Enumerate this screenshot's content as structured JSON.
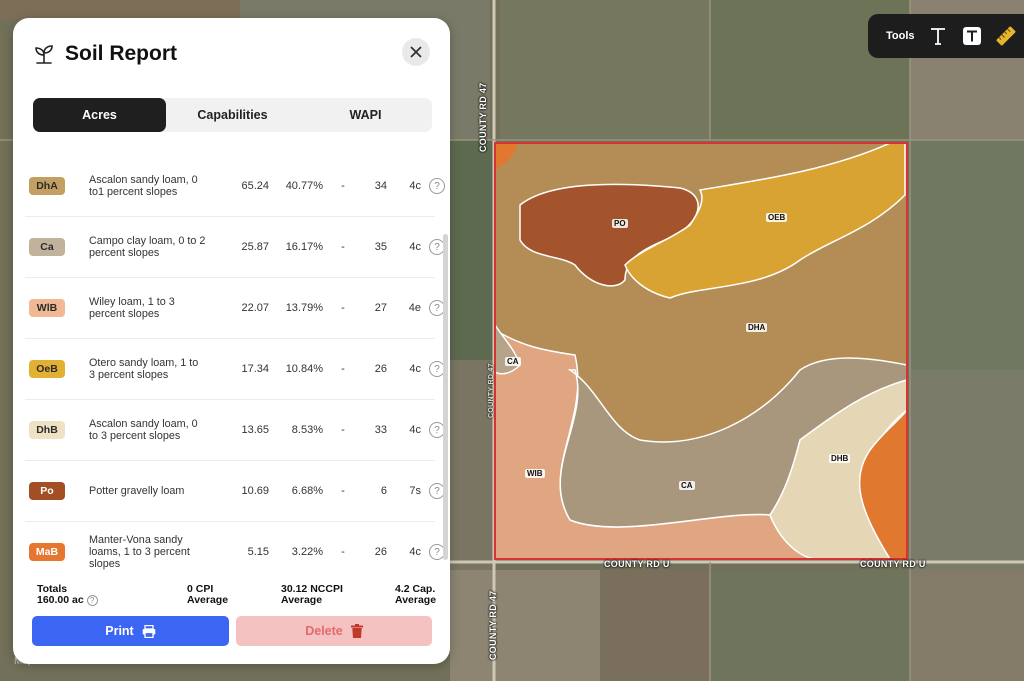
{
  "panel": {
    "title": "Soil Report",
    "tabs": [
      {
        "label": "Acres",
        "active": true
      },
      {
        "label": "Capabilities",
        "active": false
      },
      {
        "label": "WAPI",
        "active": false
      }
    ],
    "rows": [
      {
        "code": "DhA",
        "color": "#c3a061",
        "text_color": "#2b2b2b",
        "name": "Ascalon sandy loam, 0 to1 percent slopes",
        "acres": "65.24",
        "percent": "40.77%",
        "cpi": "-",
        "nccpi": "34",
        "cap": "4c"
      },
      {
        "code": "Ca",
        "color": "#c2b29b",
        "text_color": "#2b2b2b",
        "name": "Campo clay loam, 0 to 2 percent slopes",
        "acres": "25.87",
        "percent": "16.17%",
        "cpi": "-",
        "nccpi": "35",
        "cap": "4c"
      },
      {
        "code": "WlB",
        "color": "#f0b893",
        "text_color": "#2b2b2b",
        "name": "Wiley loam, 1 to 3 percent slopes",
        "acres": "22.07",
        "percent": "13.79%",
        "cpi": "-",
        "nccpi": "27",
        "cap": "4e"
      },
      {
        "code": "OeB",
        "color": "#e2b134",
        "text_color": "#2b2b2b",
        "name": "Otero sandy loam, 1 to 3 percent slopes",
        "acres": "17.34",
        "percent": "10.84%",
        "cpi": "-",
        "nccpi": "26",
        "cap": "4c"
      },
      {
        "code": "DhB",
        "color": "#efe1c3",
        "text_color": "#2b2b2b",
        "name": "Ascalon sandy loam, 0 to 3 percent slopes",
        "acres": "13.65",
        "percent": "8.53%",
        "cpi": "-",
        "nccpi": "33",
        "cap": "4c"
      },
      {
        "code": "Po",
        "color": "#a24f25",
        "text_color": "#ffffff",
        "name": "Potter gravelly loam",
        "acres": "10.69",
        "percent": "6.68%",
        "cpi": "-",
        "nccpi": "6",
        "cap": "7s"
      },
      {
        "code": "MaB",
        "color": "#e5772f",
        "text_color": "#ffffff",
        "name": "Manter-Vona sandy loams, 1 to 3 percent slopes",
        "acres": "5.15",
        "percent": "3.22%",
        "cpi": "-",
        "nccpi": "26",
        "cap": "4c"
      }
    ],
    "totals": {
      "label": "Totals",
      "acres": "160.00 ac",
      "cpi_line1": "0 CPI",
      "cpi_line2": "Average",
      "nccpi_line1": "30.12 NCCPI",
      "nccpi_line2": "Average",
      "cap_line1": "4.2 Cap.",
      "cap_line2": "Average"
    },
    "print_label": "Print",
    "delete_label": "Delete"
  },
  "tools": {
    "label": "Tools",
    "icons": [
      "text-tool-icon",
      "text-box-tool-icon",
      "ruler-tool-icon"
    ]
  },
  "map": {
    "road_labels": [
      "COUNTY RD 47",
      "COUNTY RD U",
      "COUNTY RD U",
      "COUNTY RD 47",
      "COUNTY RD 47"
    ],
    "zones": [
      "PO",
      "OEB",
      "DHA",
      "CA",
      "WIB",
      "CA",
      "DHB"
    ],
    "watermark": "Mapbox"
  },
  "colors": {
    "accent_blue": "#3b66f3",
    "delete_bg": "#f5c2c2",
    "boundary": "#d63434"
  }
}
